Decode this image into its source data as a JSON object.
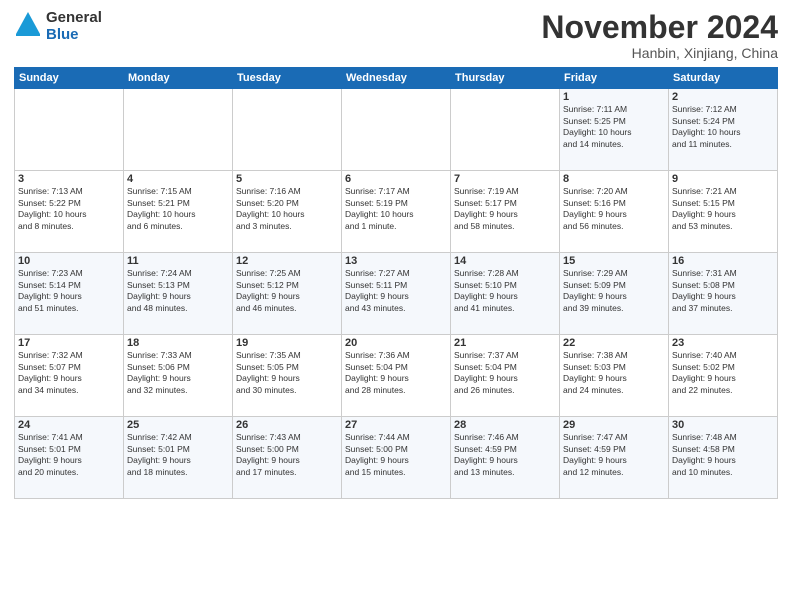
{
  "header": {
    "logo_line1": "General",
    "logo_line2": "Blue",
    "month": "November 2024",
    "location": "Hanbin, Xinjiang, China"
  },
  "weekdays": [
    "Sunday",
    "Monday",
    "Tuesday",
    "Wednesday",
    "Thursday",
    "Friday",
    "Saturday"
  ],
  "weeks": [
    [
      {
        "day": "",
        "info": ""
      },
      {
        "day": "",
        "info": ""
      },
      {
        "day": "",
        "info": ""
      },
      {
        "day": "",
        "info": ""
      },
      {
        "day": "",
        "info": ""
      },
      {
        "day": "1",
        "info": "Sunrise: 7:11 AM\nSunset: 5:25 PM\nDaylight: 10 hours\nand 14 minutes."
      },
      {
        "day": "2",
        "info": "Sunrise: 7:12 AM\nSunset: 5:24 PM\nDaylight: 10 hours\nand 11 minutes."
      }
    ],
    [
      {
        "day": "3",
        "info": "Sunrise: 7:13 AM\nSunset: 5:22 PM\nDaylight: 10 hours\nand 8 minutes."
      },
      {
        "day": "4",
        "info": "Sunrise: 7:15 AM\nSunset: 5:21 PM\nDaylight: 10 hours\nand 6 minutes."
      },
      {
        "day": "5",
        "info": "Sunrise: 7:16 AM\nSunset: 5:20 PM\nDaylight: 10 hours\nand 3 minutes."
      },
      {
        "day": "6",
        "info": "Sunrise: 7:17 AM\nSunset: 5:19 PM\nDaylight: 10 hours\nand 1 minute."
      },
      {
        "day": "7",
        "info": "Sunrise: 7:19 AM\nSunset: 5:17 PM\nDaylight: 9 hours\nand 58 minutes."
      },
      {
        "day": "8",
        "info": "Sunrise: 7:20 AM\nSunset: 5:16 PM\nDaylight: 9 hours\nand 56 minutes."
      },
      {
        "day": "9",
        "info": "Sunrise: 7:21 AM\nSunset: 5:15 PM\nDaylight: 9 hours\nand 53 minutes."
      }
    ],
    [
      {
        "day": "10",
        "info": "Sunrise: 7:23 AM\nSunset: 5:14 PM\nDaylight: 9 hours\nand 51 minutes."
      },
      {
        "day": "11",
        "info": "Sunrise: 7:24 AM\nSunset: 5:13 PM\nDaylight: 9 hours\nand 48 minutes."
      },
      {
        "day": "12",
        "info": "Sunrise: 7:25 AM\nSunset: 5:12 PM\nDaylight: 9 hours\nand 46 minutes."
      },
      {
        "day": "13",
        "info": "Sunrise: 7:27 AM\nSunset: 5:11 PM\nDaylight: 9 hours\nand 43 minutes."
      },
      {
        "day": "14",
        "info": "Sunrise: 7:28 AM\nSunset: 5:10 PM\nDaylight: 9 hours\nand 41 minutes."
      },
      {
        "day": "15",
        "info": "Sunrise: 7:29 AM\nSunset: 5:09 PM\nDaylight: 9 hours\nand 39 minutes."
      },
      {
        "day": "16",
        "info": "Sunrise: 7:31 AM\nSunset: 5:08 PM\nDaylight: 9 hours\nand 37 minutes."
      }
    ],
    [
      {
        "day": "17",
        "info": "Sunrise: 7:32 AM\nSunset: 5:07 PM\nDaylight: 9 hours\nand 34 minutes."
      },
      {
        "day": "18",
        "info": "Sunrise: 7:33 AM\nSunset: 5:06 PM\nDaylight: 9 hours\nand 32 minutes."
      },
      {
        "day": "19",
        "info": "Sunrise: 7:35 AM\nSunset: 5:05 PM\nDaylight: 9 hours\nand 30 minutes."
      },
      {
        "day": "20",
        "info": "Sunrise: 7:36 AM\nSunset: 5:04 PM\nDaylight: 9 hours\nand 28 minutes."
      },
      {
        "day": "21",
        "info": "Sunrise: 7:37 AM\nSunset: 5:04 PM\nDaylight: 9 hours\nand 26 minutes."
      },
      {
        "day": "22",
        "info": "Sunrise: 7:38 AM\nSunset: 5:03 PM\nDaylight: 9 hours\nand 24 minutes."
      },
      {
        "day": "23",
        "info": "Sunrise: 7:40 AM\nSunset: 5:02 PM\nDaylight: 9 hours\nand 22 minutes."
      }
    ],
    [
      {
        "day": "24",
        "info": "Sunrise: 7:41 AM\nSunset: 5:01 PM\nDaylight: 9 hours\nand 20 minutes."
      },
      {
        "day": "25",
        "info": "Sunrise: 7:42 AM\nSunset: 5:01 PM\nDaylight: 9 hours\nand 18 minutes."
      },
      {
        "day": "26",
        "info": "Sunrise: 7:43 AM\nSunset: 5:00 PM\nDaylight: 9 hours\nand 17 minutes."
      },
      {
        "day": "27",
        "info": "Sunrise: 7:44 AM\nSunset: 5:00 PM\nDaylight: 9 hours\nand 15 minutes."
      },
      {
        "day": "28",
        "info": "Sunrise: 7:46 AM\nSunset: 4:59 PM\nDaylight: 9 hours\nand 13 minutes."
      },
      {
        "day": "29",
        "info": "Sunrise: 7:47 AM\nSunset: 4:59 PM\nDaylight: 9 hours\nand 12 minutes."
      },
      {
        "day": "30",
        "info": "Sunrise: 7:48 AM\nSunset: 4:58 PM\nDaylight: 9 hours\nand 10 minutes."
      }
    ]
  ]
}
